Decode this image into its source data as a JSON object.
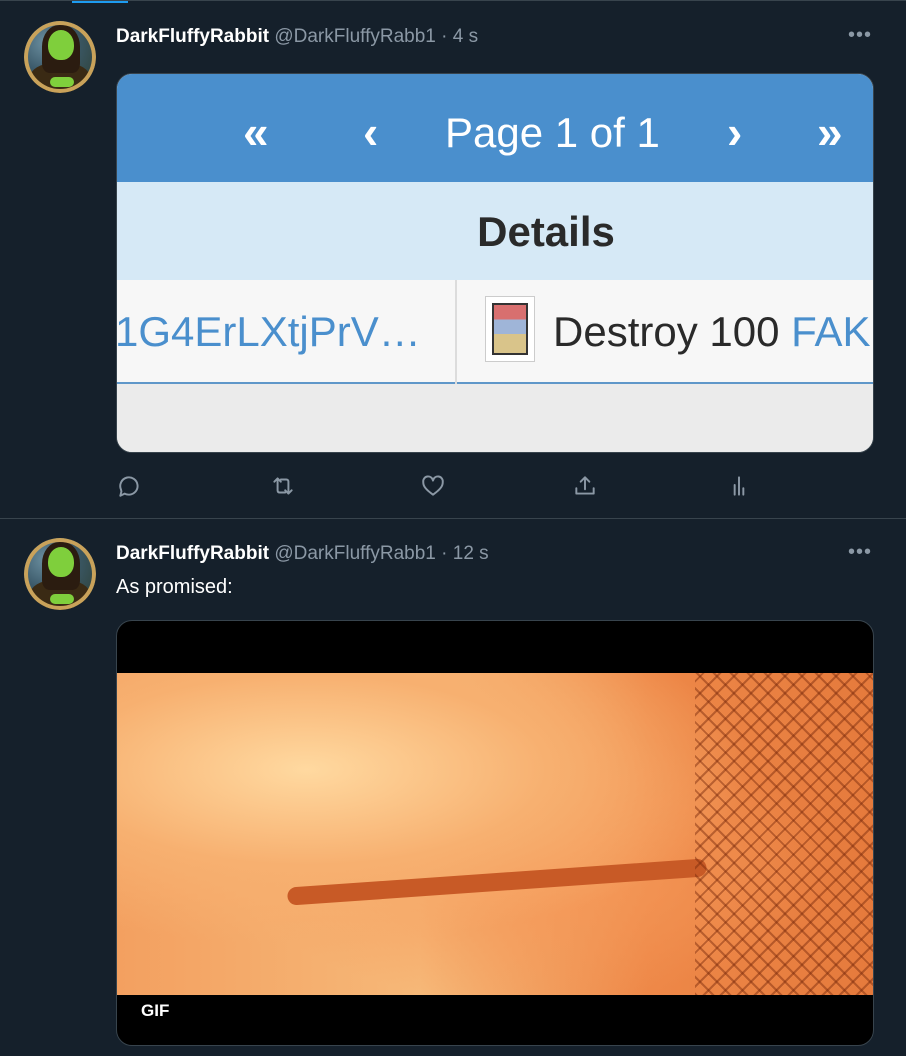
{
  "tweets": [
    {
      "name": "DarkFluffyRabbit",
      "handle": "@DarkFluffyRabb1",
      "separator": "·",
      "time": "4 s",
      "more": "•••",
      "media": {
        "pager": {
          "first": "«",
          "prev": "‹",
          "label": "Page 1 of 1",
          "next": "›",
          "last": "»"
        },
        "column_header": "Details",
        "row": {
          "tx": "1G4ErLXtjPrV…",
          "action": "Destroy 100",
          "asset": "FAK"
        }
      }
    },
    {
      "name": "DarkFluffyRabbit",
      "handle": "@DarkFluffyRabb1",
      "separator": "·",
      "time": "12 s",
      "more": "•••",
      "text": "As promised:",
      "media": {
        "badge": "GIF"
      }
    }
  ],
  "actions": [
    "reply-icon",
    "retweet-icon",
    "like-icon",
    "share-icon",
    "analytics-icon"
  ],
  "colors": {
    "background": "#15202b",
    "border": "#38444d",
    "muted": "#8b98a5",
    "pager": "#4a8fcd"
  }
}
